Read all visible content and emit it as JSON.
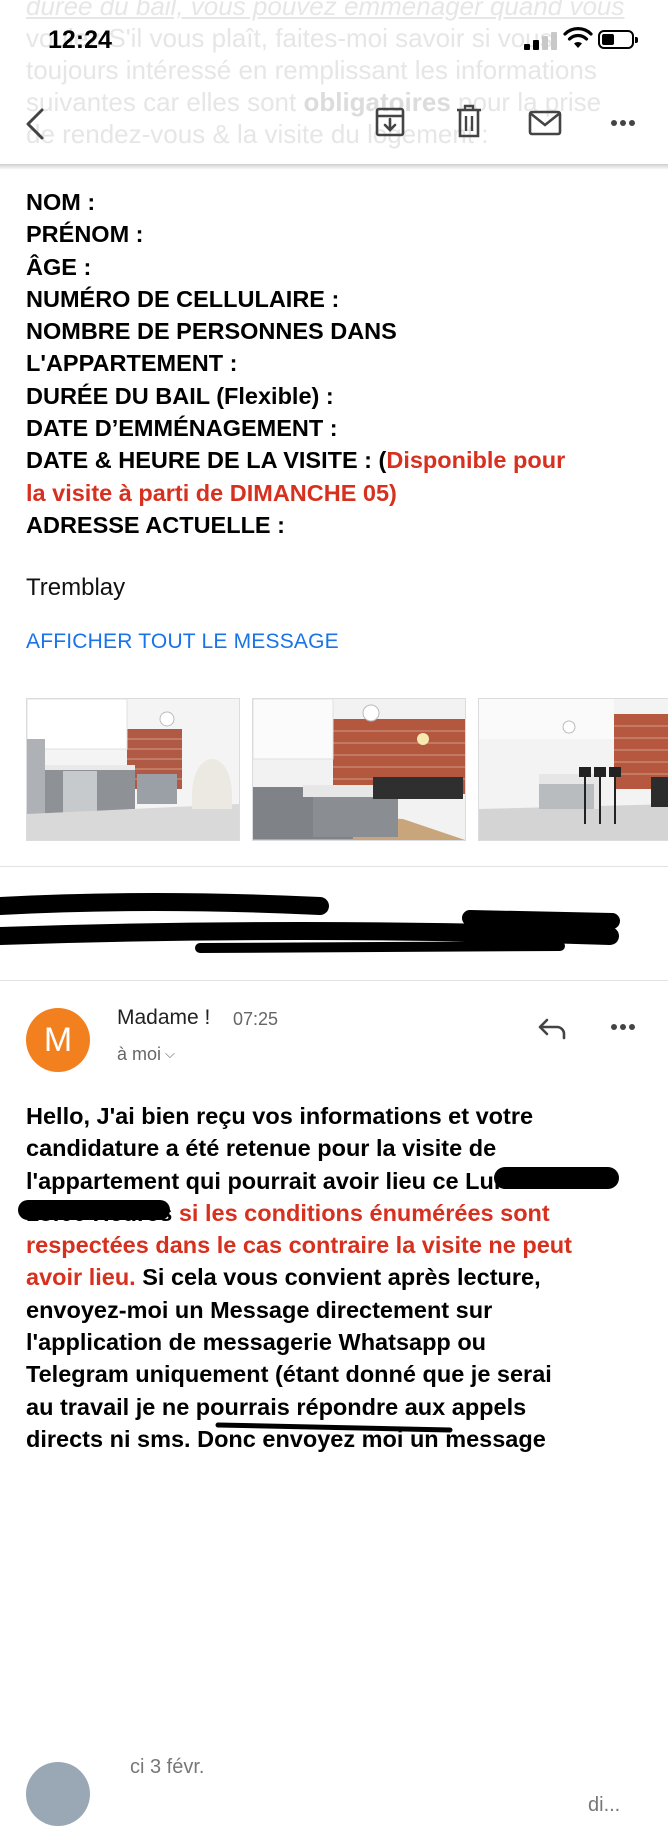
{
  "background_text": {
    "line1": "durée du bail, vous pouvez emménager quand vous",
    "line2": "voulez S'il vous plaît, faites-moi savoir si vous",
    "line3": "toujours intéressé en remplissant les informations",
    "line4_a": "suivantes car elles sont ",
    "line4_b": "obligatoires",
    "line4_c": " pour la prise",
    "line5": "de rendez-vous & la visite du logement :"
  },
  "status_bar": {
    "time": "12:24"
  },
  "toolbar": {
    "icons": [
      "back-arrow-icon",
      "archive-icon",
      "trash-icon",
      "mail-icon",
      "more-icon"
    ]
  },
  "form_fields": {
    "nom": "NOM :",
    "prenom": "PRÉNOM :",
    "age": "ÂGE :",
    "cellulaire": "NUMÉRO DE CELLULAIRE :",
    "personnes_1": "NOMBRE DE PERSONNES DANS",
    "personnes_2": "L'APPARTEMENT :",
    "duree": "DURÉE DU BAIL (Flexible) :",
    "emmenagement": "DATE D’EMMÉNAGEMENT :",
    "visite_a": "DATE & HEURE DE LA VISITE : (",
    "visite_b": "Disponible pour",
    "visite_c": "la visite à parti de DIMANCHE 05)",
    "adresse": "ADRESSE ACTUELLE :"
  },
  "signature": "Tremblay",
  "show_all_link": "AFFICHER TOUT LE MESSAGE",
  "attachments": [
    "kitchen-photo-1",
    "kitchen-photo-2",
    "kitchen-photo-3"
  ],
  "collapsed_message": {
    "name_fragment": "ci 3 févr.",
    "snippet_fragment": "di..."
  },
  "message": {
    "avatar_letter": "M",
    "sender": "Madame !",
    "time": "07:25",
    "recipient": "à moi",
    "line1": "Hello, J'ai bien reçu vos informations et votre",
    "line2": "candidature a été retenue pour la visite de",
    "line3": "l'appartement qui pourrait avoir lieu ce Lundi à",
    "line4_a": "18:00 Heures",
    "line4_b": " si les conditions énumérées sont",
    "line5": "respectées dans le cas contraire la visite ne peut",
    "line6_a": "avoir lieu.",
    "line6_b": " Si cela vous convient après lecture,",
    "line7": "envoyez-moi un Message directement sur",
    "line8": "l'application de messagerie Whatsapp ou",
    "line9": "Telegram uniquement (étant donné que je serai",
    "line10": "au travail je ne pourrais répondre aux appels",
    "line11": "directs ni sms. Donc envoyez moi un message"
  },
  "colors": {
    "accent_red": "#d7301f",
    "link_blue": "#1a73e8",
    "avatar_orange": "#f3801f"
  }
}
